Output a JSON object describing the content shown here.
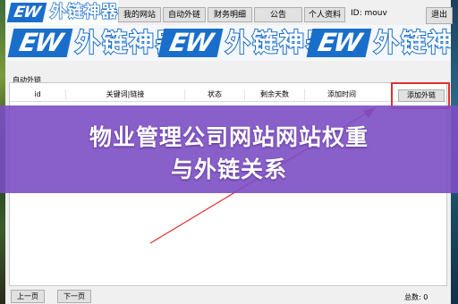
{
  "app": {
    "logo": {
      "latin": "EW",
      "chinese": "外链神器"
    },
    "nav": [
      "我的网站",
      "自动外链",
      "财务明细",
      "公告",
      "个人资料"
    ],
    "id_label": "ID: mouv",
    "close_label": "退出"
  },
  "watermark": {
    "latin": "EW",
    "chinese": "外链神器"
  },
  "panel": {
    "title": "自动外链",
    "columns": [
      "id",
      "关键词|链接",
      "状态",
      "剩余天数",
      "添加时间"
    ],
    "add_button": "添加外链",
    "rows": []
  },
  "footer": {
    "prev": "上一页",
    "next": "下一页",
    "total": "总数: 0"
  },
  "overlay": {
    "line1": "物业管理公司网站网站权重",
    "line2": "与外链关系"
  },
  "colors": {
    "overlay": "#7c4ec4",
    "highlight": "#e0302f",
    "brand_blue": "#1a6ecb"
  }
}
